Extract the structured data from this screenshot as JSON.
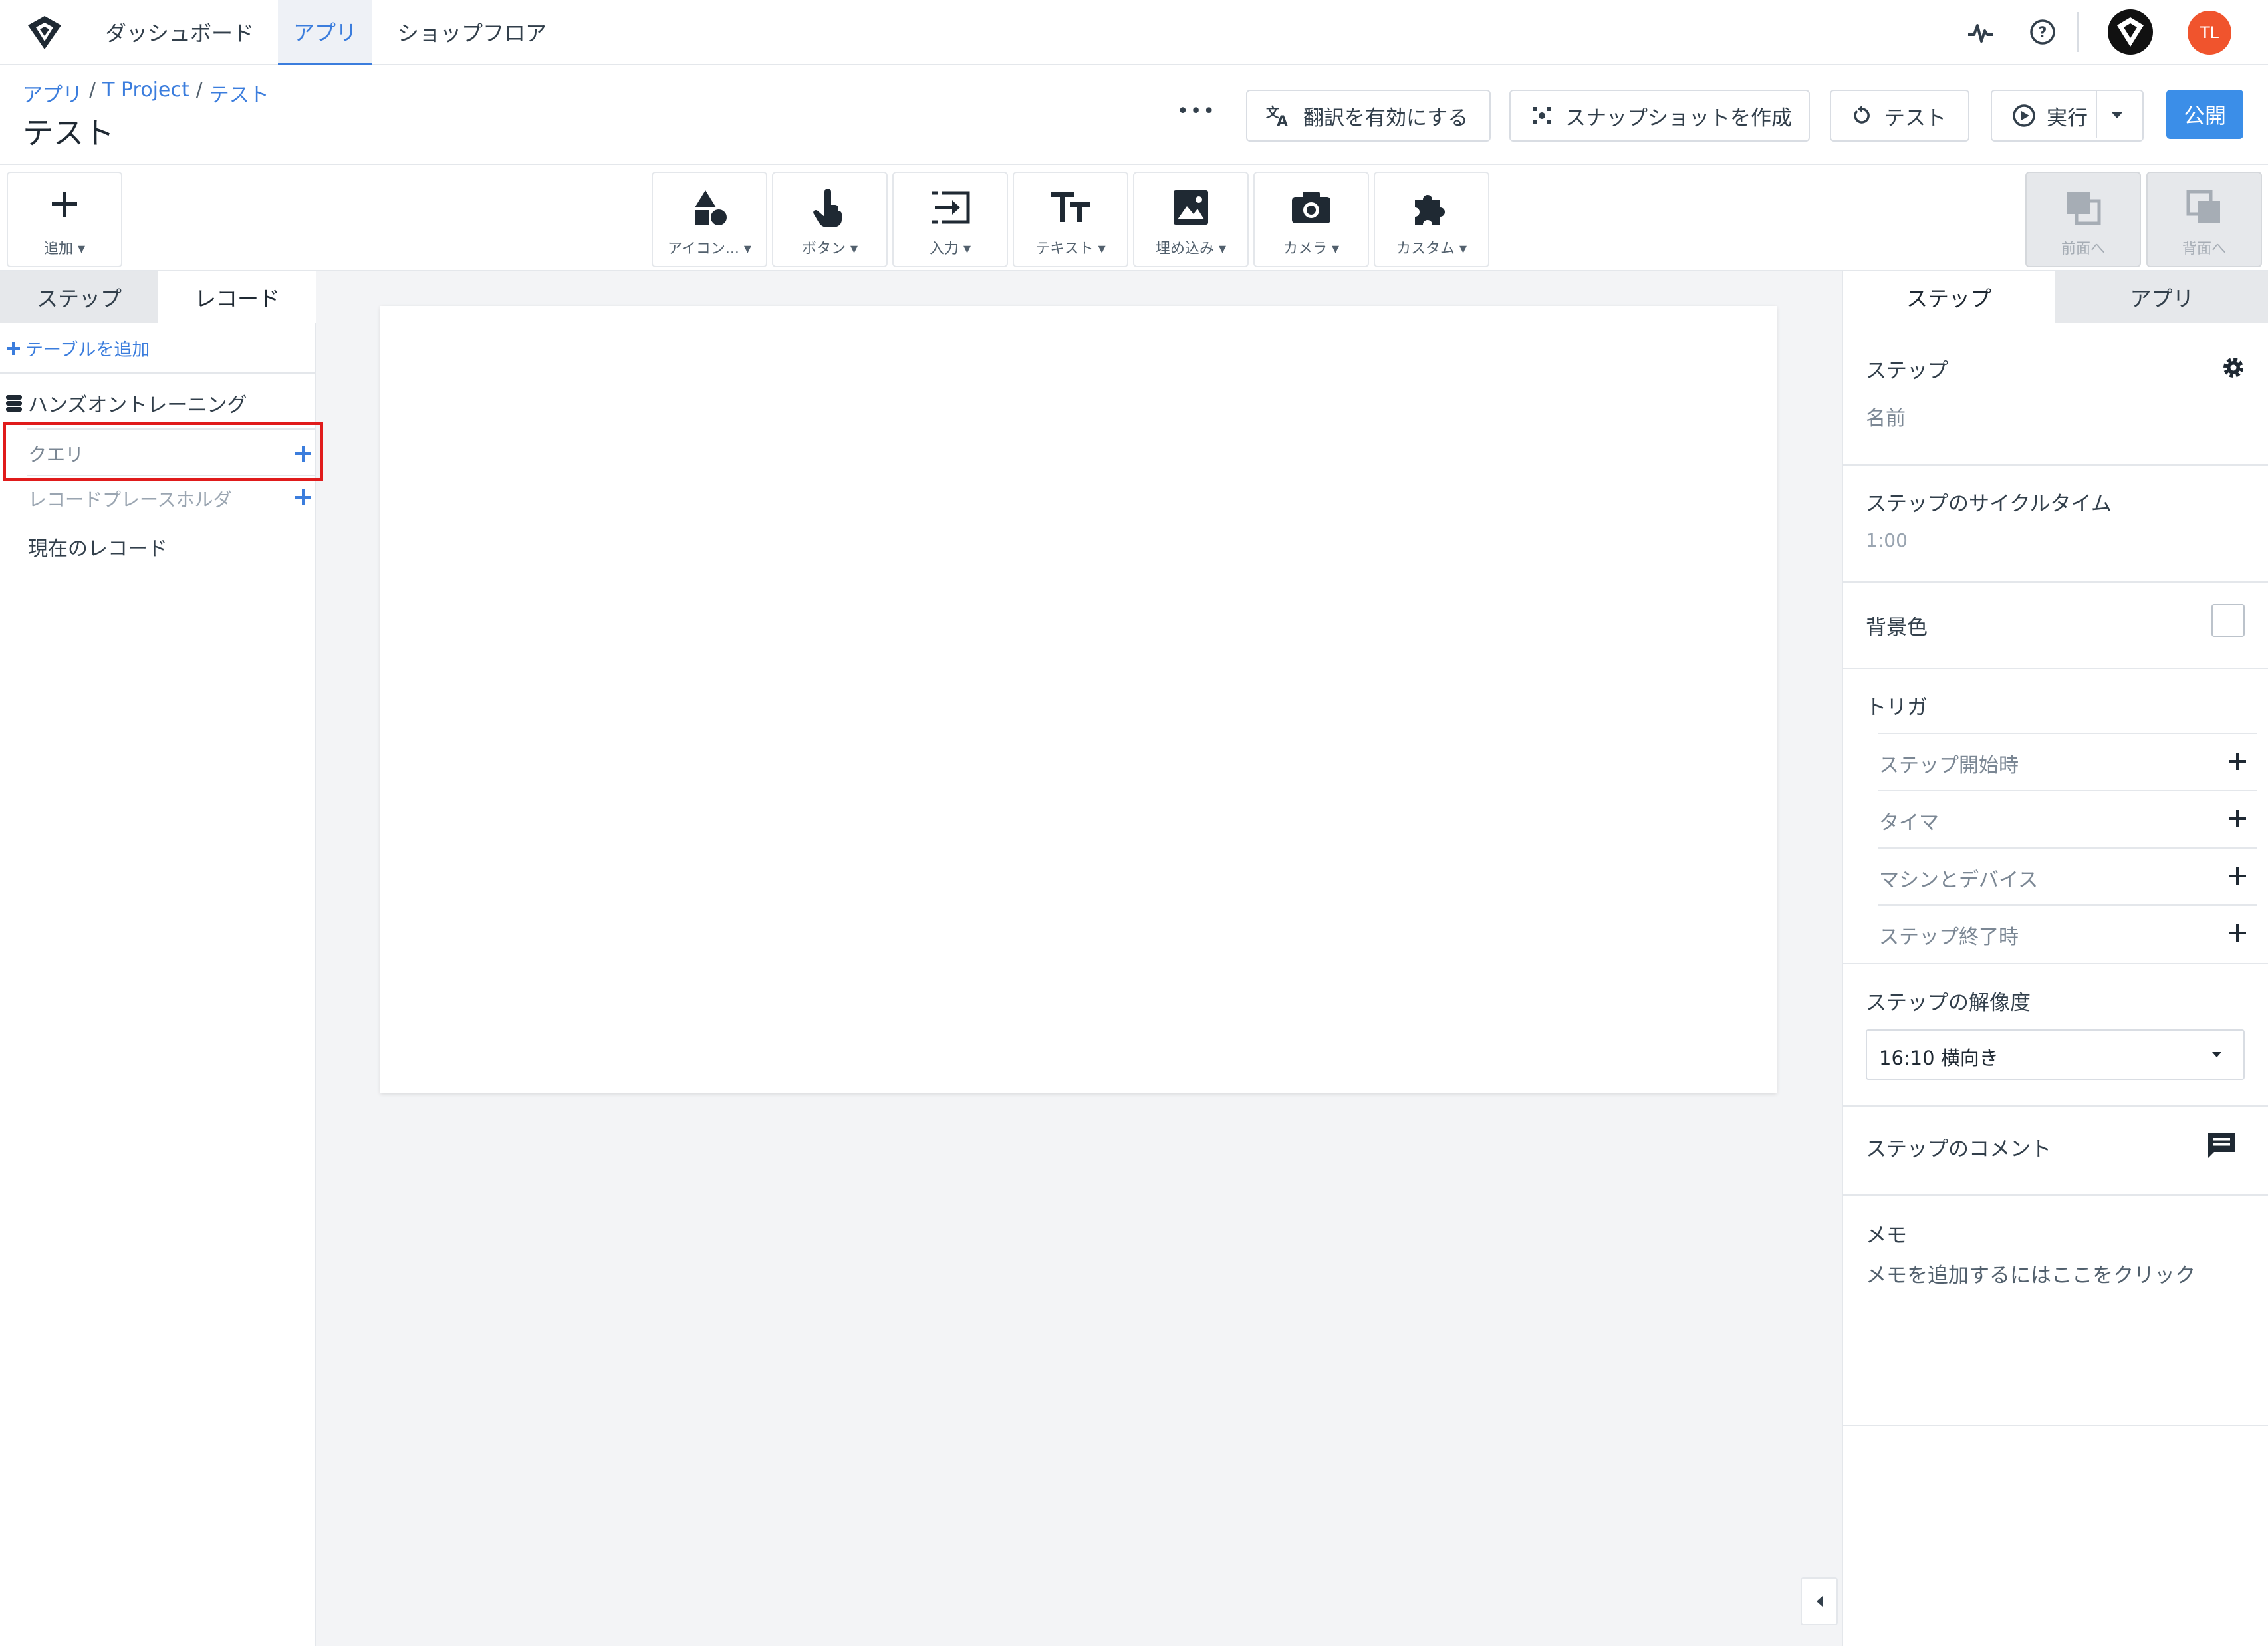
{
  "nav": {
    "tabs": [
      {
        "label": "ダッシュボード",
        "active": false
      },
      {
        "label": "アプリ",
        "active": true
      },
      {
        "label": "ショップフロア",
        "active": false
      }
    ],
    "avatar_initials": "TL",
    "icons": [
      "logo-icon",
      "activity-icon",
      "help-icon",
      "factory-logo-icon"
    ]
  },
  "header": {
    "breadcrumb": [
      "アプリ",
      "T Project",
      "テスト"
    ],
    "separator": "/",
    "title": "テスト",
    "more_label": "•••",
    "translate_label": "翻訳を有効にする",
    "snapshot_label": "スナップショットを作成",
    "test_label": "テスト",
    "run_label": "実行",
    "publish_label": "公開"
  },
  "toolbar": {
    "add_label": "追加",
    "tools": [
      {
        "label": "アイコン...",
        "icon": "shapes-icon"
      },
      {
        "label": "ボタン",
        "icon": "pointer-hand-icon"
      },
      {
        "label": "入力",
        "icon": "input-icon"
      },
      {
        "label": "テキスト",
        "icon": "text-size-icon"
      },
      {
        "label": "埋め込み",
        "icon": "image-icon"
      },
      {
        "label": "カメラ",
        "icon": "camera-icon"
      },
      {
        "label": "カスタム",
        "icon": "puzzle-icon"
      }
    ],
    "bring_front_label": "前面へ",
    "send_back_label": "背面へ"
  },
  "left": {
    "tabs": [
      {
        "label": "ステップ",
        "active": false
      },
      {
        "label": "レコード",
        "active": true
      }
    ],
    "add_table_label": "テーブルを追加",
    "table_name": "ハンズオントレーニング",
    "query_label": "クエリ",
    "placeholder_label": "レコードプレースホルダ",
    "current_record_label": "現在のレコード"
  },
  "right": {
    "tabs": [
      {
        "label": "ステップ",
        "active": true
      },
      {
        "label": "アプリ",
        "active": false
      }
    ],
    "step_label": "ステップ",
    "name_placeholder": "名前",
    "cycle_time_label": "ステップのサイクルタイム",
    "cycle_time_value": "1:00",
    "bg_color_label": "背景色",
    "triggers_label": "トリガ",
    "triggers": [
      "ステップ開始時",
      "タイマ",
      "マシンとデバイス",
      "ステップ終了時"
    ],
    "resolution_label": "ステップの解像度",
    "resolution_value": "16:10 横向き",
    "comment_label": "ステップのコメント",
    "memo_label": "メモ",
    "memo_placeholder": "メモを追加するにはここをクリック"
  },
  "colors": {
    "accent": "#3b7ddd",
    "publish_bg": "#3b8ee8",
    "avatar_bg": "#f0542d",
    "highlight": "#e01b1b"
  }
}
